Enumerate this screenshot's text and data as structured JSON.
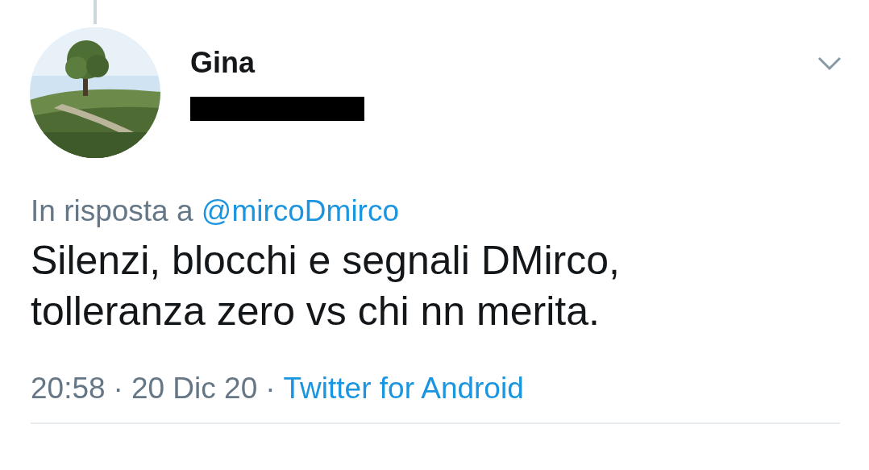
{
  "tweet": {
    "author": {
      "name": "Gina"
    },
    "reply_to": {
      "label": "In risposta a",
      "handle": "@mircoDmirco"
    },
    "text_lines": [
      "Silenzi, blocchi e segnali DMirco,",
      "tolleranza zero vs chi nn merita."
    ],
    "meta": {
      "time": "20:58",
      "separator_1": "·",
      "date": "20 Dic 20",
      "separator_2": "·",
      "source": "Twitter for Android"
    }
  }
}
